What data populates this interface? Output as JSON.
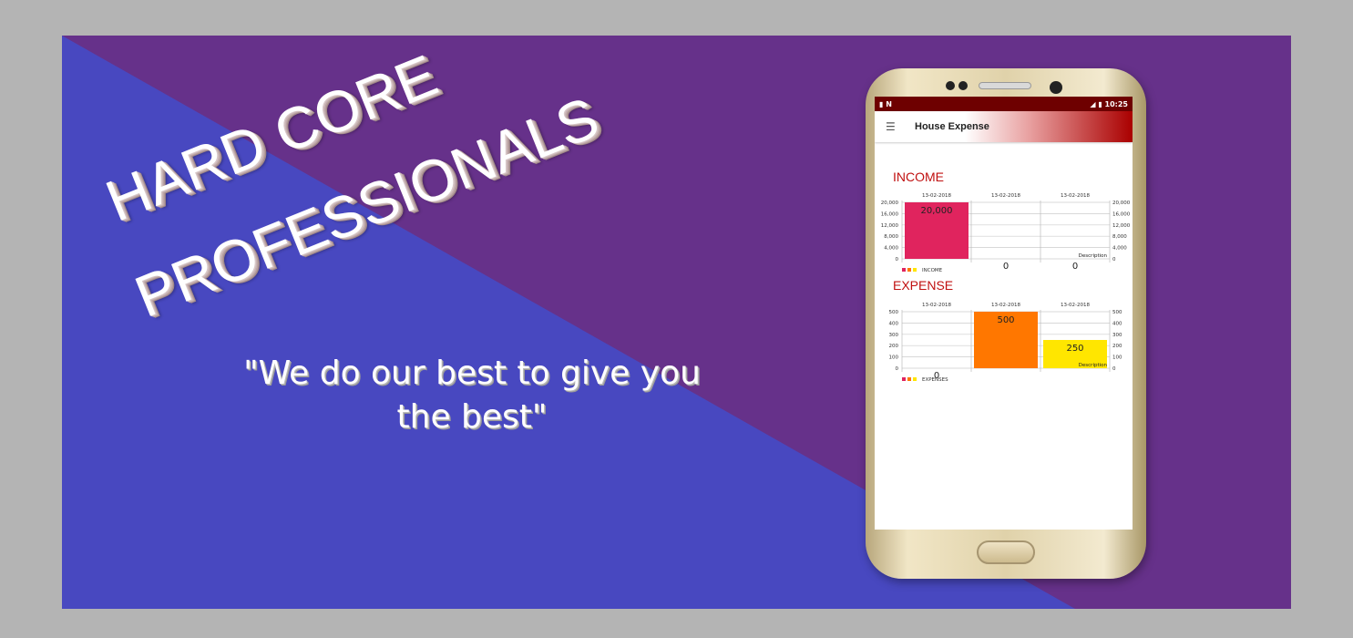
{
  "banner": {
    "headline_line1": "HARD CORE",
    "headline_line2": "PROFESSIONALS",
    "quote_line1": "\"We do our  best to give you",
    "quote_line2": "the best\"",
    "colors": {
      "purple": "#66318a",
      "blue": "#4848c0",
      "background": "#b4b4b4"
    }
  },
  "app": {
    "status": {
      "time": "10:25",
      "icons": [
        "sd-card-icon",
        "nfc-icon",
        "signal-icon",
        "battery-icon"
      ]
    },
    "title": "House Expense",
    "menu_icon": "hamburger-icon",
    "income": {
      "heading": "INCOME",
      "dates": [
        "13-02-2018",
        "13-02-2018",
        "13-02-2018"
      ],
      "values": [
        20000,
        0,
        0
      ],
      "value_labels": [
        "20,000",
        "0",
        "0"
      ],
      "y_ticks": [
        "0",
        "4,000",
        "8,000",
        "12,000",
        "16,000",
        "20,000"
      ],
      "ymax": 20000,
      "description": "Description",
      "legend": "INCOME",
      "bar_colors": [
        "#e0245e",
        "#ff7700",
        "#ffe600"
      ]
    },
    "expense": {
      "heading": "EXPENSE",
      "dates": [
        "13-02-2018",
        "13-02-2018",
        "13-02-2018"
      ],
      "values": [
        0,
        500,
        250
      ],
      "value_labels": [
        "0",
        "500",
        "250"
      ],
      "y_ticks": [
        "0",
        "100",
        "200",
        "300",
        "400",
        "500"
      ],
      "ymax": 500,
      "description": "Description",
      "legend": "EXPENSES",
      "bar_colors": [
        "#e0245e",
        "#ff7700",
        "#ffe600"
      ]
    }
  }
}
